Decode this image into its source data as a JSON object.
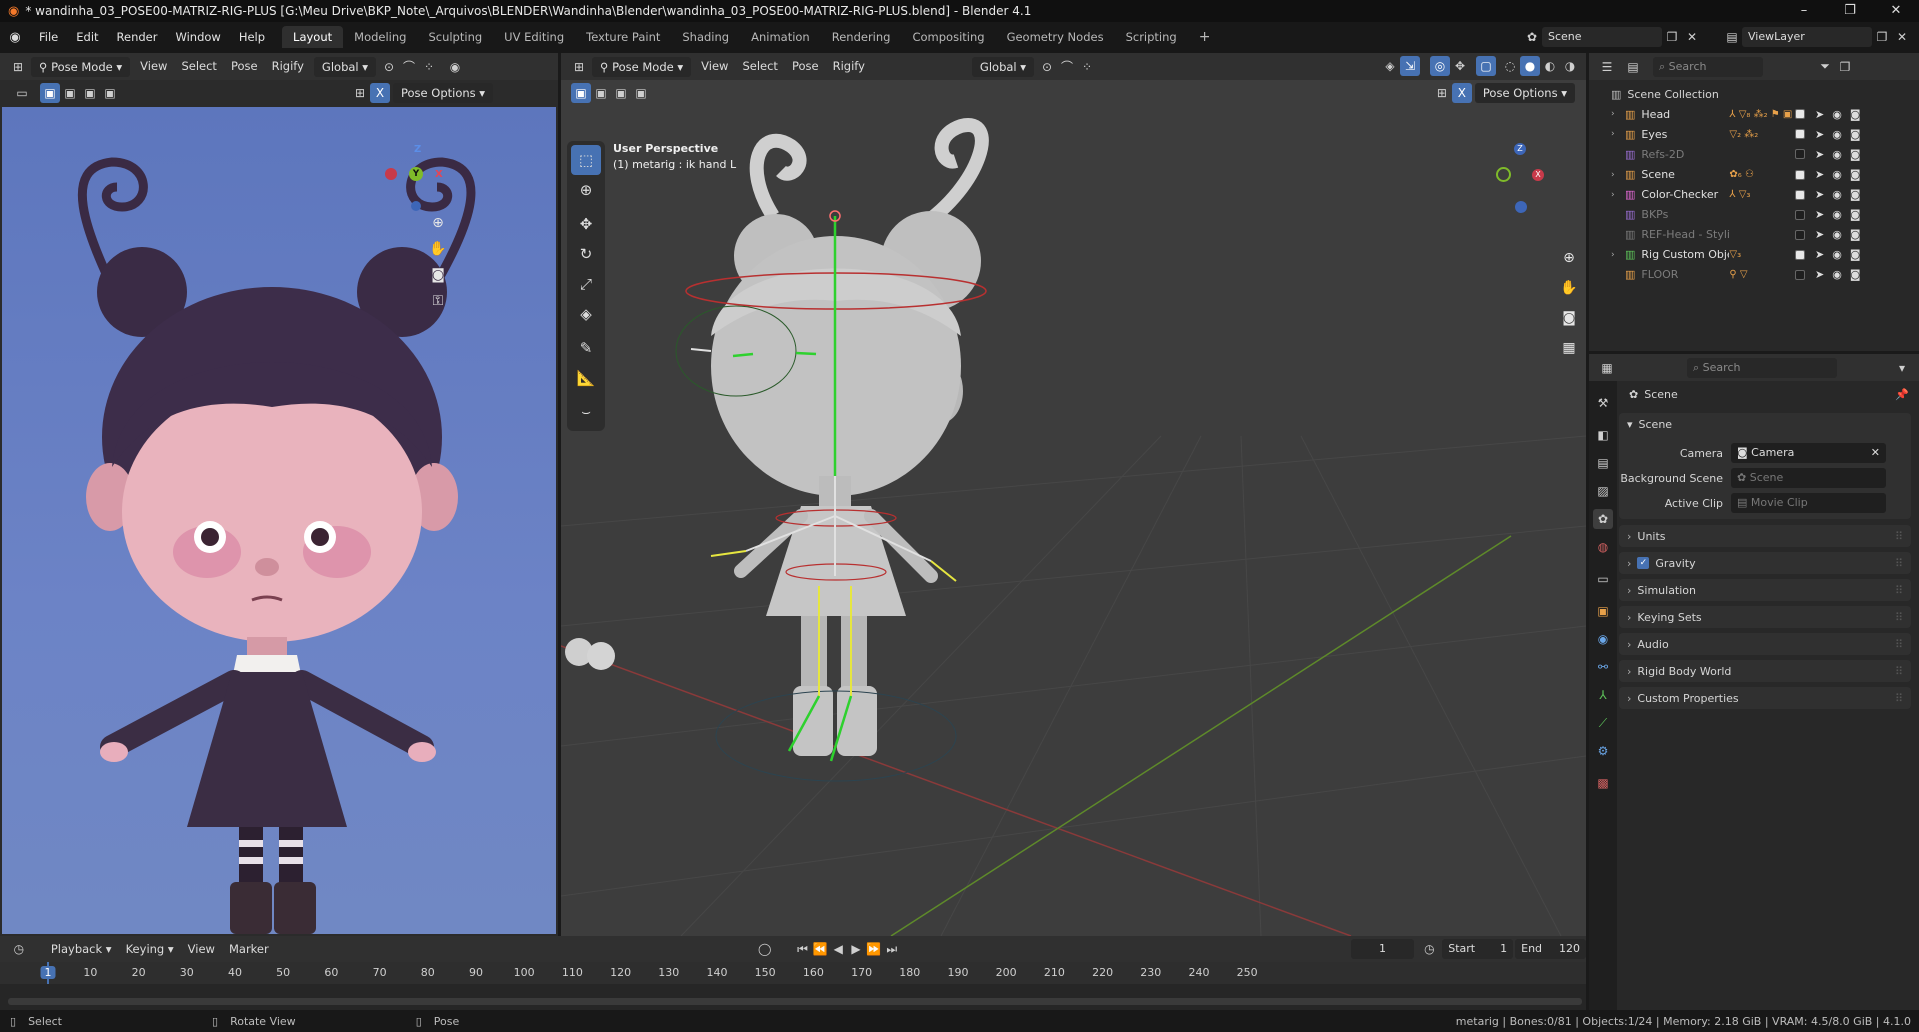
{
  "window": {
    "title": "* wandinha_03_POSE00-MATRIZ-RIG-PLUS [G:\\Meu Drive\\BKP_Note\\_Arquivos\\BLENDER\\Wandinha\\Blender\\wandinha_03_POSE00-MATRIZ-RIG-PLUS.blend] - Blender 4.1",
    "minimize": "–",
    "maximize": "❐",
    "close": "✕"
  },
  "menus": [
    "File",
    "Edit",
    "Render",
    "Window",
    "Help"
  ],
  "workspaces": [
    "Layout",
    "Modeling",
    "Sculpting",
    "UV Editing",
    "Texture Paint",
    "Shading",
    "Animation",
    "Rendering",
    "Compositing",
    "Geometry Nodes",
    "Scripting"
  ],
  "active_workspace": "Layout",
  "scene_field": "Scene",
  "viewlayer_field": "ViewLayer",
  "left_view": {
    "mode": "Pose Mode",
    "menus": [
      "View",
      "Select",
      "Pose",
      "Rigify"
    ],
    "transform": "Global",
    "pose_options": "Pose Options"
  },
  "main_view": {
    "mode": "Pose Mode",
    "menus": [
      "View",
      "Select",
      "Pose",
      "Rigify"
    ],
    "transform": "Global",
    "pose_options": "Pose Options",
    "overlay_title": "User Perspective",
    "overlay_sub": "(1) metarig : ik hand L"
  },
  "gizmo": {
    "x": "X",
    "y": "Y",
    "z": "Z"
  },
  "outliner": {
    "search_placeholder": "Search",
    "root": "Scene Collection",
    "items": [
      {
        "name": "Head",
        "color": "#e8a14a",
        "dim": false,
        "checked": true,
        "extras": "⅄ ▽₈ ⁂₂ ⚑ ▣"
      },
      {
        "name": "Eyes",
        "color": "#e8a14a",
        "dim": false,
        "checked": true,
        "extras": "▽₂ ⁂₂"
      },
      {
        "name": "Refs-2D",
        "color": "#9c6fd6",
        "dim": true,
        "checked": false,
        "extras": ""
      },
      {
        "name": "Scene",
        "color": "#e8a14a",
        "dim": false,
        "checked": true,
        "extras": "✿₆ ⚇"
      },
      {
        "name": "Color-Checker",
        "color": "#e66ad8",
        "dim": false,
        "checked": true,
        "extras": "⅄ ▽₃"
      },
      {
        "name": "BKPs",
        "color": "#9c6fd6",
        "dim": true,
        "checked": false,
        "extras": ""
      },
      {
        "name": "REF-Head - Stylized",
        "color": "#7a7a7a",
        "dim": true,
        "checked": false,
        "extras": ""
      },
      {
        "name": "Rig Custom Objects",
        "color": "#5ec45a",
        "dim": false,
        "checked": true,
        "extras": "▽₃"
      },
      {
        "name": "FLOOR",
        "color": "#e8a14a",
        "dim": true,
        "checked": false,
        "extras": "⚲ ▽"
      }
    ]
  },
  "properties": {
    "search_placeholder": "Search",
    "context": "Scene",
    "panel": "Scene",
    "camera_label": "Camera",
    "camera_value": "Camera",
    "background_label": "Background Scene",
    "background_placeholder": "Scene",
    "clip_label": "Active Clip",
    "clip_placeholder": "Movie Clip",
    "subpanels": [
      "Units",
      "Gravity",
      "Simulation",
      "Keying Sets",
      "Audio",
      "Rigid Body World",
      "Custom Properties"
    ]
  },
  "timeline": {
    "menus": [
      "Playback",
      "Keying",
      "View",
      "Marker"
    ],
    "current_frame": "1",
    "start_label": "Start",
    "start_value": "1",
    "end_label": "End",
    "end_value": "120",
    "ticks": [
      "1",
      "10",
      "20",
      "30",
      "40",
      "50",
      "60",
      "70",
      "80",
      "90",
      "100",
      "110",
      "120",
      "130",
      "140",
      "150",
      "160",
      "170",
      "180",
      "190",
      "200",
      "210",
      "220",
      "230",
      "240",
      "250"
    ]
  },
  "statusbar": {
    "select": "Select",
    "rotate": "Rotate View",
    "pose": "Pose",
    "stats": "metarig | Bones:0/81 | Objects:1/24 | Memory: 2.18 GiB | VRAM: 4.5/8.0 GiB | 4.1.0"
  },
  "colors": {
    "accent": "#4772b3",
    "header": "#303030",
    "viewport_bg": "#3c3c3c",
    "left_bg": "#6b82c4"
  }
}
